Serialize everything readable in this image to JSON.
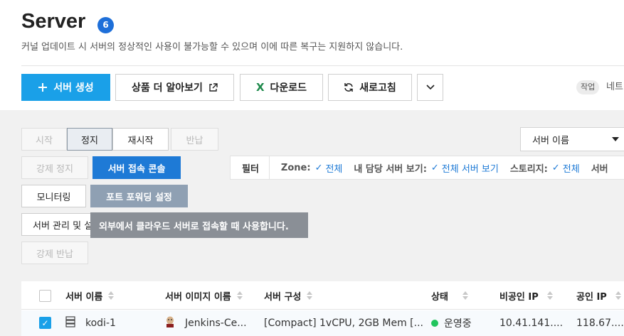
{
  "header": {
    "title": "Server",
    "count": "6",
    "notice": "커널 업데이트 시 서버의 정상적인 사용이 불가능할 수 있으며 이에 따른 복구는 지원하지 않습니다."
  },
  "toolbar": {
    "create_label": "서버 생성",
    "learn_more_label": "상품 더 알아보기",
    "download_label": "다운로드",
    "refresh_label": "새로고침",
    "task_label": "작업",
    "task_text": "네트"
  },
  "actions": {
    "start": "시작",
    "stop": "정지",
    "restart": "재시작",
    "return": "반납",
    "force_stop": "강제 정지",
    "console": "서버 접속 콘솔",
    "monitoring": "모니터링",
    "port_forwarding": "포트 포워딩 설정",
    "server_manage": "서버 관리 및 설정",
    "force_return": "강제 반납"
  },
  "tooltip": "외부에서 클라우드 서버로 접속할 때 사용합니다.",
  "search": {
    "select_value": "서버 이름"
  },
  "filter": {
    "label": "필터",
    "zone_label": "Zone:",
    "zone_value": "전체",
    "owner_label": "내 담당 서버 보기:",
    "owner_value": "전체 서버 보기",
    "storage_label": "스토리지:",
    "storage_value": "전체",
    "more_label": "서버"
  },
  "table": {
    "columns": [
      "서버 이름",
      "서버 이미지 이름",
      "서버 구성",
      "상태",
      "비공인 IP",
      "공인 IP"
    ],
    "rows": [
      {
        "name": "kodi-1",
        "image": "Jenkins-Ce...",
        "spec": "[Compact] 1vCPU, 2GB Mem [...",
        "status": "운영중",
        "private_ip": "10.41.141....",
        "public_ip": "118.67...."
      }
    ]
  },
  "colors": {
    "primary": "#1aa0e8",
    "console_button": "#1e7ad6",
    "badge": "#1e6fd9",
    "status_running": "#22c55e",
    "tooltip_bg": "#8a8f96"
  }
}
